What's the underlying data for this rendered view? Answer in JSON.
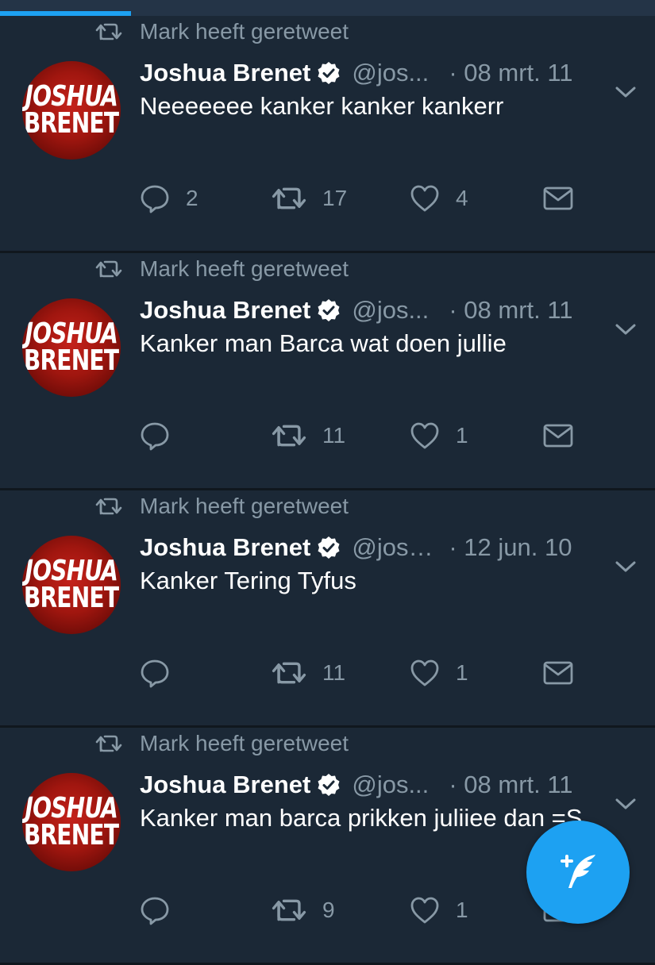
{
  "colors": {
    "background": "#1b2836",
    "accent": "#1da1f2",
    "secondary_text": "#8899a6"
  },
  "progress": 0.2,
  "tweets": [
    {
      "retweeted_by": "Mark heeft geretweet",
      "avatar_text_1": "JOSHUA",
      "avatar_text_2": "BRENET",
      "name": "Joshua Brenet",
      "handle": "@jos...",
      "date": "· 08 mrt. 11",
      "text": "Neeeeeee kanker kanker kankerr",
      "replies": "2",
      "retweets": "17",
      "likes": "4"
    },
    {
      "retweeted_by": "Mark heeft geretweet",
      "avatar_text_1": "JOSHUA",
      "avatar_text_2": "BRENET",
      "name": "Joshua Brenet",
      "handle": "@jos...",
      "date": "· 08 mrt. 11",
      "text": "Kanker man Barca wat doen jullie",
      "replies": "",
      "retweets": "11",
      "likes": "1"
    },
    {
      "retweeted_by": "Mark heeft geretweet",
      "avatar_text_1": "JOSHUA",
      "avatar_text_2": "BRENET",
      "name": "Joshua Brenet",
      "handle": "@josh...",
      "date": "· 12 jun. 10",
      "text": "Kanker Tering Tyfus",
      "replies": "",
      "retweets": "11",
      "likes": "1"
    },
    {
      "retweeted_by": "Mark heeft geretweet",
      "avatar_text_1": "JOSHUA",
      "avatar_text_2": "BRENET",
      "name": "Joshua Brenet",
      "handle": "@jos...",
      "date": "· 08 mrt. 11",
      "text": "Kanker man barca prikken juliiee dan =S",
      "replies": "",
      "retweets": "9",
      "likes": "1"
    }
  ],
  "icons": {
    "retweet_small": "retweet-icon",
    "verified": "verified-badge-icon",
    "caret": "chevron-down-icon",
    "reply": "reply-icon",
    "retweet": "retweet-icon",
    "like": "heart-icon",
    "dm": "envelope-icon",
    "compose": "compose-tweet-icon"
  }
}
